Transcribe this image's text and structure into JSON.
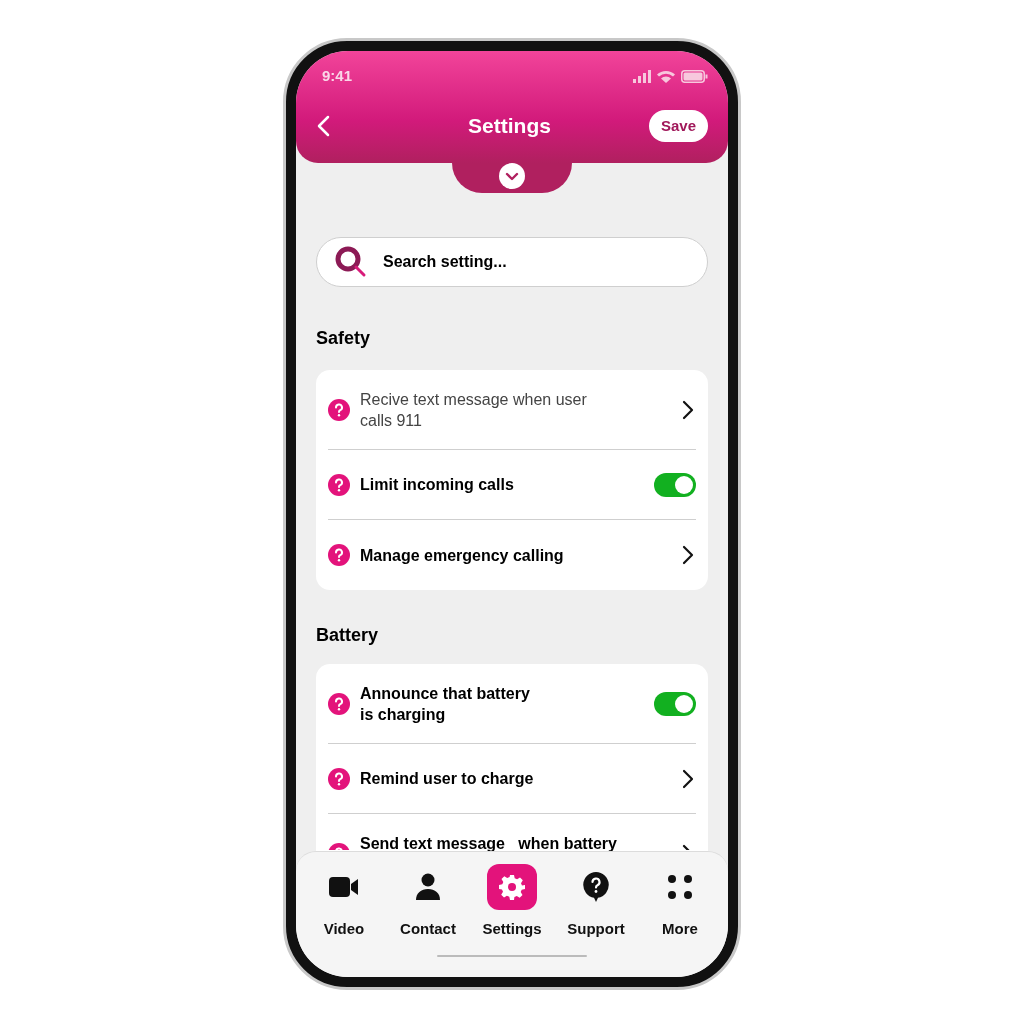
{
  "status_bar": {
    "time": "9:41"
  },
  "header": {
    "title": "Settings",
    "save_label": "Save"
  },
  "search": {
    "placeholder": "Search setting..."
  },
  "sections": [
    {
      "title": "Safety",
      "rows": [
        {
          "kind": "link",
          "label": "Recive text message when user calls 911",
          "bold": false
        },
        {
          "kind": "toggle",
          "label": "Limit incoming calls",
          "bold": true,
          "on": true
        },
        {
          "kind": "link",
          "label": "Manage emergency calling",
          "bold": true
        }
      ]
    },
    {
      "title": "Battery",
      "rows": [
        {
          "kind": "toggle",
          "label": "Announce that battery is charging",
          "bold": true,
          "on": true
        },
        {
          "kind": "link",
          "label": "Remind user to charge",
          "bold": true
        },
        {
          "kind": "link",
          "label": "Send text message   when battery",
          "bold": true
        }
      ]
    }
  ],
  "tabs": [
    {
      "kind": "video",
      "label": "Video",
      "selected": false
    },
    {
      "kind": "contact",
      "label": "Contact",
      "selected": false
    },
    {
      "kind": "settings",
      "label": "Settings",
      "selected": true
    },
    {
      "kind": "support",
      "label": "Support",
      "selected": false
    },
    {
      "kind": "more",
      "label": "More",
      "selected": false
    }
  ]
}
